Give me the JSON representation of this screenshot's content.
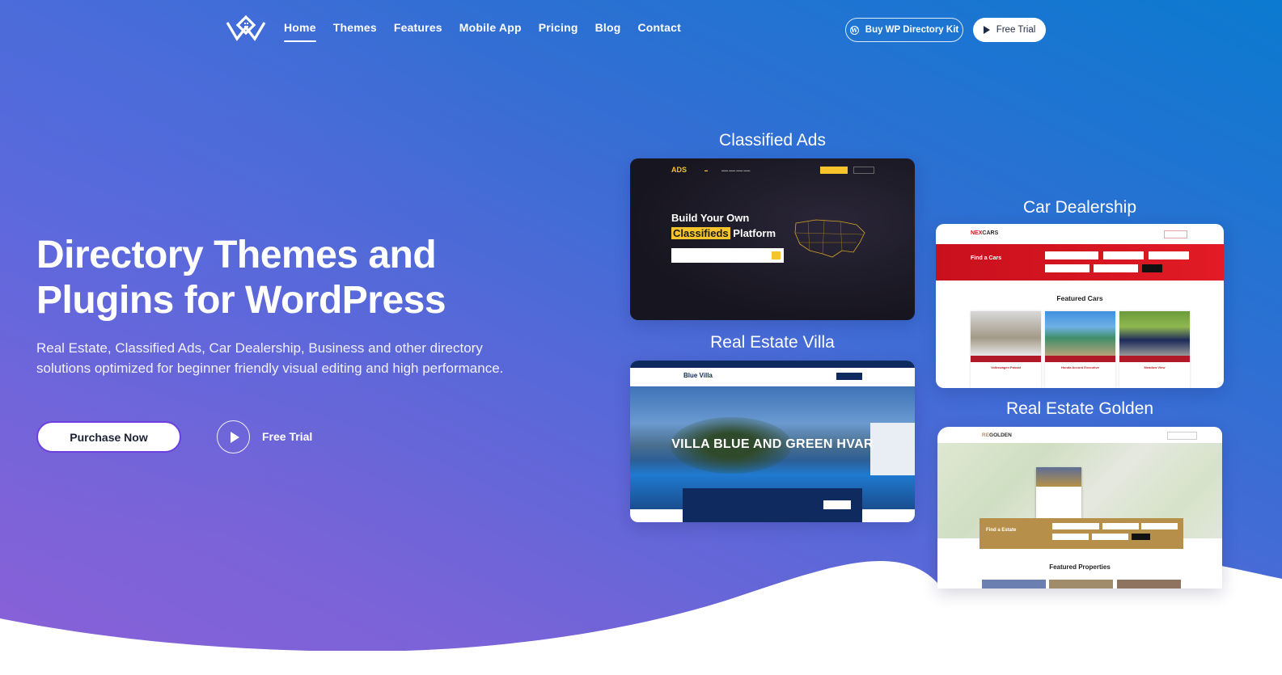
{
  "nav": {
    "items": [
      {
        "label": "Home",
        "active": true
      },
      {
        "label": "Themes",
        "active": false
      },
      {
        "label": "Features",
        "active": false
      },
      {
        "label": "Mobile App",
        "active": false
      },
      {
        "label": "Pricing",
        "active": false
      },
      {
        "label": "Blog",
        "active": false
      },
      {
        "label": "Contact",
        "active": false
      }
    ],
    "buy_button": {
      "label": "Buy WP Directory Kit",
      "icon": "wordpress-icon"
    },
    "trial_button": {
      "label": "Free Trial",
      "icon": "play-icon"
    }
  },
  "hero": {
    "headline_line1": "Directory Themes and",
    "headline_line2": "Plugins for WordPress",
    "subtext": "Real Estate, Classified Ads, Car Dealership, Business and other directory solutions optimized for beginner friendly visual editing and high performance.",
    "purchase_label": "Purchase Now",
    "free_trial_label": "Free Trial"
  },
  "previews": {
    "classified": {
      "title": "Classified Ads",
      "brand": "ADS",
      "headline_1": "Build Your Own",
      "headline_highlight": "Classifieds",
      "headline_2": "Platform"
    },
    "villa": {
      "title": "Real Estate Villa",
      "brand": "Blue Villa",
      "hero_title": "VILLA BLUE AND GREEN HVAR"
    },
    "cars": {
      "title": "Car Dealership",
      "brand_accent": "NEX",
      "brand_rest": "CARS",
      "banner_title": "Find a Cars",
      "section_title": "Featured Cars",
      "listings": [
        "Volkswagen Passat",
        "Honda Accord Executive",
        "Meadow View"
      ]
    },
    "golden": {
      "title": "Real Estate Golden",
      "brand_accent": "RE",
      "brand_rest": "GOLDEN",
      "search_title": "Find a Estate",
      "section_title": "Featured Properties"
    }
  },
  "colors": {
    "gradient_blue": "#0b7ad0",
    "gradient_purple": "#8a60d8",
    "ads_yellow": "#f7c42c",
    "cars_red": "#d0141f",
    "villa_navy": "#0e2a5e",
    "golden": "#b6904a"
  }
}
